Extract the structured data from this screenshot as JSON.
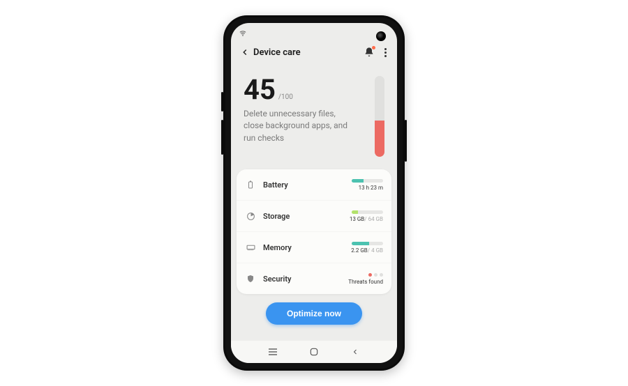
{
  "header": {
    "title": "Device care"
  },
  "score": {
    "value": "45",
    "max": "/100",
    "advice": "Delete unnecessary files, close background apps, and run checks",
    "fill_pct": 45
  },
  "rows": {
    "battery": {
      "label": "Battery",
      "detail": "13 h 23 m",
      "fill_pct": 38
    },
    "storage": {
      "label": "Storage",
      "used": "13 GB",
      "total": "/ 64 GB",
      "fill_pct": 20
    },
    "memory": {
      "label": "Memory",
      "used": "2.2 GB",
      "total": "/ 4 GB",
      "fill_pct": 55
    },
    "security": {
      "label": "Security",
      "detail": "Threats found"
    }
  },
  "cta": {
    "label": "Optimize now"
  },
  "colors": {
    "accent_teal": "#4cc2b0",
    "accent_green": "#b3e26b",
    "danger": "#ec6a62",
    "button": "#3a94f0"
  }
}
